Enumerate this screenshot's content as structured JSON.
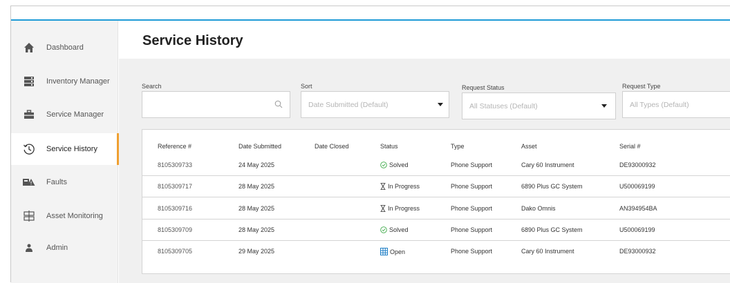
{
  "page": {
    "title": "Service History"
  },
  "sidebar": {
    "items": [
      {
        "label": "Dashboard",
        "icon": "home-icon"
      },
      {
        "label": "Inventory Manager",
        "icon": "server-icon"
      },
      {
        "label": "Service Manager",
        "icon": "toolbox-icon"
      },
      {
        "label": "Service History",
        "icon": "history-icon",
        "active": true
      },
      {
        "label": "Faults",
        "icon": "fault-icon"
      },
      {
        "label": "Asset Monitoring",
        "icon": "monitoring-icon"
      },
      {
        "label": "Admin",
        "icon": "user-icon"
      }
    ]
  },
  "filters": {
    "search": {
      "label": "Search",
      "placeholder": ""
    },
    "sort": {
      "label": "Sort",
      "value": "Date Submitted (Default)"
    },
    "status": {
      "label": "Request Status",
      "value": "All Statuses (Default)"
    },
    "type": {
      "label": "Request Type",
      "value": "All Types (Default)"
    }
  },
  "table": {
    "headers": [
      "Reference #",
      "Date Submitted",
      "Date Closed",
      "Status",
      "Type",
      "Asset",
      "Serial #"
    ],
    "rows": [
      {
        "ref": "8105309733",
        "submitted": "24 May 2025",
        "closed": "",
        "status": "Solved",
        "status_icon": "check-circle-icon",
        "type": "Phone Support",
        "asset": "Cary 60 Instrument",
        "serial": "DE93000932"
      },
      {
        "ref": "8105309717",
        "submitted": "28 May 2025",
        "closed": "",
        "status": "In Progress",
        "status_icon": "hourglass-icon",
        "type": "Phone Support",
        "asset": "6890 Plus GC System",
        "serial": "U500069199"
      },
      {
        "ref": "8105309716",
        "submitted": "28 May 2025",
        "closed": "",
        "status": "In Progress",
        "status_icon": "hourglass-icon",
        "type": "Phone Support",
        "asset": "Dako Omnis",
        "serial": "AN394954BA"
      },
      {
        "ref": "8105309709",
        "submitted": "28 May 2025",
        "closed": "",
        "status": "Solved",
        "status_icon": "check-circle-icon",
        "type": "Phone Support",
        "asset": "6890 Plus GC System",
        "serial": "U500069199"
      },
      {
        "ref": "8105309705",
        "submitted": "29 May 2025",
        "closed": "",
        "status": "Open",
        "status_icon": "grid-icon",
        "type": "Phone Support",
        "asset": "Cary 60 Instrument",
        "serial": "DE93000932"
      }
    ]
  },
  "colors": {
    "accent": "#1f9bd7",
    "active_marker": "#f0a030",
    "solved": "#3aa845",
    "open": "#1f7fc6"
  }
}
